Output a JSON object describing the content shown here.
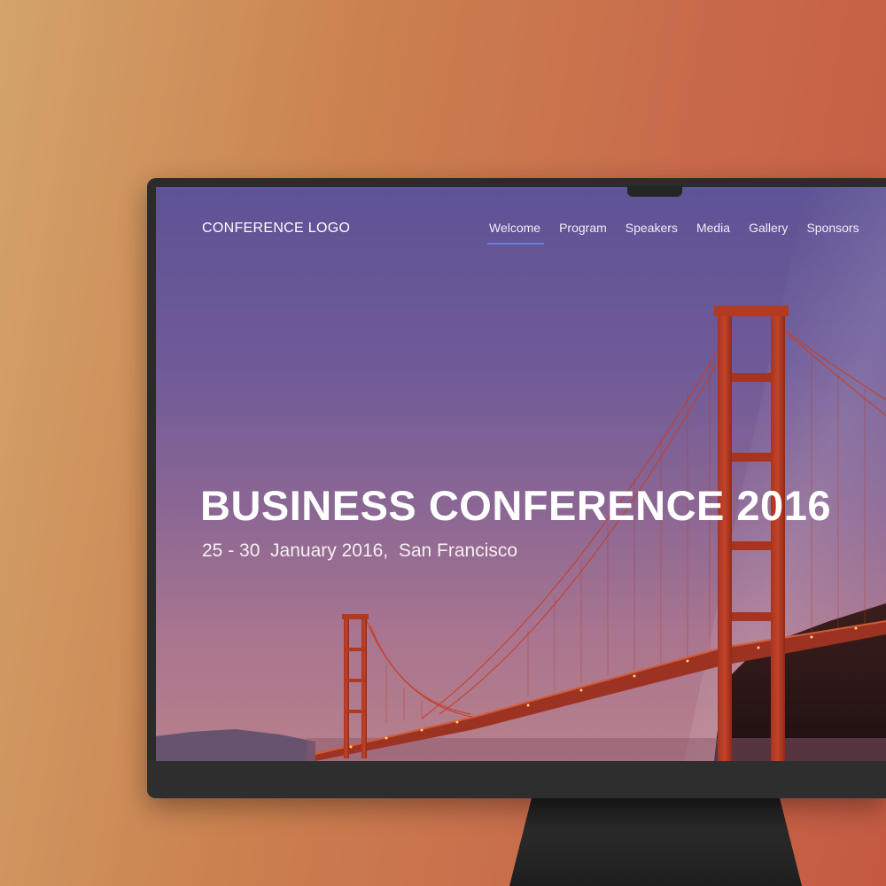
{
  "site": {
    "logo": "CONFERENCE LOGO",
    "nav": [
      {
        "label": "Welcome",
        "active": true
      },
      {
        "label": "Program",
        "active": false
      },
      {
        "label": "Speakers",
        "active": false
      },
      {
        "label": "Media",
        "active": false
      },
      {
        "label": "Gallery",
        "active": false
      },
      {
        "label": "Sponsors",
        "active": false
      }
    ],
    "accent_color": "#6b7fe0"
  },
  "hero": {
    "title": "BUSINESS CONFERENCE 2016",
    "subtitle": "25 - 30  January 2016,  San Francisco",
    "background_image": "golden-gate-bridge-sunset"
  },
  "device": {
    "type": "desktop-monitor",
    "frame_color": "#2b2b2b"
  },
  "backdrop": {
    "gradient_start": "#d3a36b",
    "gradient_end": "#c45a42"
  }
}
